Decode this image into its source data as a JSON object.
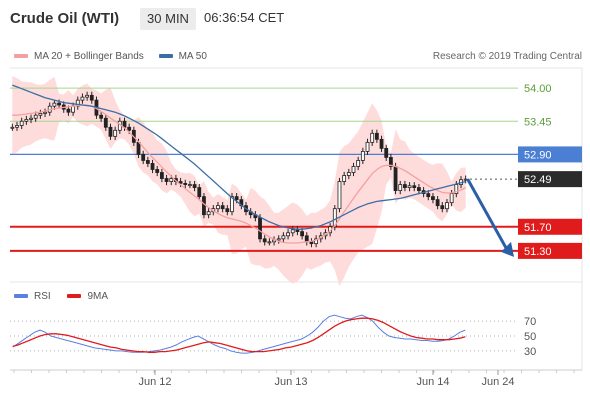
{
  "header": {
    "title": "Crude Oil (WTI)",
    "timeframe": "30 MIN",
    "time": "06:36:54 CET"
  },
  "legend": {
    "bb_label": "MA 20 + Bollinger Bands",
    "ma50_label": "MA 50",
    "credit": "Research © 2019 Trading Central"
  },
  "sub_legend": {
    "rsi_label": "RSI",
    "ma9_label": "9MA"
  },
  "colors": {
    "candle": "#555555",
    "band_fill": "#ffd6d6",
    "ma20": "#f5a0a0",
    "ma50": "#3b6ea5",
    "resistance": "#a6d68c",
    "pivot": "#4a7fd4",
    "support": "#e01b1b",
    "price_tag": "#2b2b2b",
    "arrow": "#2a5fa8",
    "rsi": "#5b7fe0",
    "rsi_ma": "#e01b1b"
  },
  "chart_data": [
    {
      "type": "candlestick",
      "title": "Crude Oil (WTI)",
      "timeframe": "30 MIN",
      "x_ticks": [
        "Jun 12",
        "Jun 13",
        "Jun 14",
        "Jun 24"
      ],
      "y_range": [
        50.9,
        54.3
      ],
      "levels": [
        {
          "value": 54.0,
          "label": "54.00",
          "kind": "resistance"
        },
        {
          "value": 53.45,
          "label": "53.45",
          "kind": "resistance"
        },
        {
          "value": 52.9,
          "label": "52.90",
          "kind": "pivot"
        },
        {
          "value": 52.49,
          "label": "52.49",
          "kind": "last"
        },
        {
          "value": 51.7,
          "label": "51.70",
          "kind": "support"
        },
        {
          "value": 51.3,
          "label": "51.30",
          "kind": "support"
        }
      ],
      "last_price": 52.49,
      "close": [
        53.35,
        53.38,
        53.45,
        53.48,
        53.5,
        53.55,
        53.58,
        53.6,
        53.7,
        53.75,
        53.72,
        53.65,
        53.6,
        53.7,
        53.8,
        53.85,
        53.88,
        53.8,
        53.55,
        53.5,
        53.35,
        53.2,
        53.3,
        53.45,
        53.35,
        53.3,
        53.1,
        52.9,
        52.8,
        52.75,
        52.65,
        52.6,
        52.5,
        52.45,
        52.5,
        52.45,
        52.42,
        52.4,
        52.4,
        52.35,
        52.2,
        51.9,
        51.95,
        52.0,
        52.05,
        52.0,
        51.95,
        52.2,
        52.15,
        52.05,
        51.95,
        51.9,
        51.85,
        51.5,
        51.45,
        51.45,
        51.48,
        51.5,
        51.55,
        51.6,
        51.65,
        51.62,
        51.55,
        51.45,
        51.42,
        51.5,
        51.55,
        51.6,
        51.7,
        52.0,
        52.45,
        52.55,
        52.6,
        52.7,
        52.8,
        52.95,
        53.1,
        53.25,
        53.15,
        53.0,
        52.85,
        52.7,
        52.3,
        52.4,
        52.35,
        52.38,
        52.35,
        52.3,
        52.25,
        52.2,
        52.15,
        52.05,
        52.0,
        52.1,
        52.25,
        52.4,
        52.48,
        52.49
      ],
      "ma20": [
        53.55,
        53.55,
        53.56,
        53.57,
        53.58,
        53.59,
        53.6,
        53.62,
        53.64,
        53.66,
        53.67,
        53.68,
        53.69,
        53.7,
        53.71,
        53.72,
        53.72,
        53.7,
        53.66,
        53.61,
        53.56,
        53.5,
        53.45,
        53.4,
        53.34,
        53.27,
        53.19,
        53.11,
        53.02,
        52.93,
        52.85,
        52.77,
        52.69,
        52.61,
        52.54,
        52.46,
        52.4,
        52.33,
        52.27,
        52.21,
        52.15,
        52.08,
        52.02,
        51.96,
        51.92,
        51.88,
        51.85,
        51.83,
        51.81,
        51.79,
        51.76,
        51.72,
        51.68,
        51.63,
        51.58,
        51.53,
        51.49,
        51.46,
        51.44,
        51.43,
        51.43,
        51.43,
        51.44,
        51.45,
        51.46,
        51.48,
        51.52,
        51.57,
        51.63,
        51.72,
        51.83,
        51.95,
        52.06,
        52.17,
        52.28,
        52.38,
        52.48,
        52.58,
        52.65,
        52.7,
        52.72,
        52.72,
        52.7,
        52.67,
        52.63,
        52.58,
        52.53,
        52.48,
        52.43,
        52.38,
        52.34,
        52.3,
        52.27,
        52.26,
        52.26,
        52.28,
        52.31,
        52.35
      ],
      "ma50": [
        54.05,
        54.02,
        53.99,
        53.96,
        53.93,
        53.9,
        53.87,
        53.84,
        53.82,
        53.8,
        53.78,
        53.76,
        53.75,
        53.74,
        53.73,
        53.72,
        53.71,
        53.7,
        53.68,
        53.66,
        53.64,
        53.62,
        53.6,
        53.57,
        53.54,
        53.5,
        53.46,
        53.42,
        53.37,
        53.32,
        53.27,
        53.22,
        53.16,
        53.1,
        53.04,
        52.98,
        52.92,
        52.86,
        52.8,
        52.74,
        52.67,
        52.6,
        52.53,
        52.46,
        52.39,
        52.32,
        52.25,
        52.18,
        52.12,
        52.06,
        52.0,
        51.95,
        51.9,
        51.86,
        51.82,
        51.78,
        51.75,
        51.72,
        51.7,
        51.68,
        51.67,
        51.66,
        51.66,
        51.67,
        51.68,
        51.7,
        51.72,
        51.75,
        51.78,
        51.82,
        51.86,
        51.9,
        51.94,
        51.98,
        52.02,
        52.05,
        52.08,
        52.1,
        52.12,
        52.13,
        52.14,
        52.15,
        52.16,
        52.17,
        52.19,
        52.21,
        52.23,
        52.25,
        52.27,
        52.29,
        52.31,
        52.33,
        52.35,
        52.37,
        52.39,
        52.41,
        52.43,
        52.45
      ]
    },
    {
      "type": "line",
      "title": "RSI",
      "x_ticks": [
        "Jun 12",
        "Jun 13",
        "Jun 14",
        "Jun 24"
      ],
      "y_ticks": [
        30,
        50,
        70
      ],
      "ylim": [
        15,
        85
      ],
      "series": [
        {
          "name": "RSI",
          "values": [
            35,
            40,
            45,
            50,
            55,
            58,
            55,
            50,
            48,
            46,
            44,
            42,
            40,
            38,
            36,
            34,
            33,
            32,
            31,
            30,
            30,
            29,
            28,
            28,
            28,
            29,
            30,
            31,
            33,
            35,
            38,
            42,
            45,
            48,
            50,
            46,
            42,
            38,
            35,
            33,
            30,
            28,
            27,
            27,
            28,
            30,
            32,
            34,
            36,
            38,
            40,
            42,
            44,
            46,
            50,
            55,
            62,
            70,
            76,
            78,
            76,
            74,
            73,
            76,
            78,
            75,
            70,
            62,
            55,
            50,
            48,
            47,
            46,
            46,
            45,
            44,
            44,
            43,
            43,
            44,
            46,
            50,
            55,
            58
          ]
        },
        {
          "name": "9MA",
          "values": [
            36,
            38,
            41,
            44,
            47,
            50,
            52,
            53,
            53,
            52,
            51,
            49,
            47,
            45,
            43,
            41,
            39,
            37,
            35,
            34,
            32,
            31,
            30,
            29,
            29,
            28,
            28,
            29,
            29,
            30,
            31,
            33,
            35,
            37,
            39,
            41,
            42,
            41,
            40,
            38,
            36,
            34,
            32,
            30,
            29,
            29,
            29,
            30,
            31,
            32,
            34,
            35,
            37,
            39,
            41,
            44,
            48,
            53,
            58,
            63,
            67,
            70,
            72,
            73,
            74,
            74,
            73,
            71,
            68,
            64,
            60,
            56,
            53,
            50,
            48,
            47,
            46,
            46,
            45,
            45,
            45,
            46,
            47,
            49
          ]
        }
      ]
    }
  ]
}
